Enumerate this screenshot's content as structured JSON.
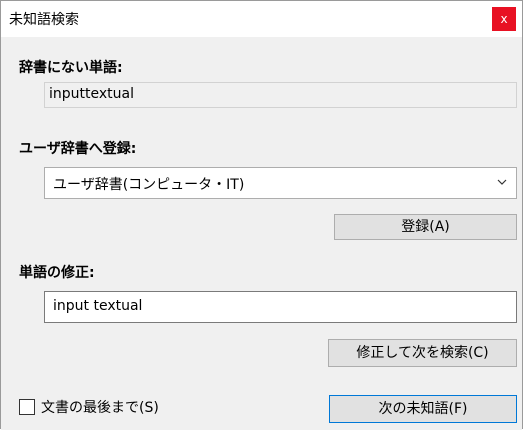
{
  "window": {
    "title": "未知語検索",
    "close_symbol": "x"
  },
  "labels": {
    "not_in_dict": "辞書にない単語:",
    "register_to": "ユーザ辞書へ登録:",
    "correction": "単語の修正:"
  },
  "fields": {
    "unknown_word": "inputtextual",
    "dictionary_selected": "ユーザ辞書(コンピュータ・IT)",
    "corrected_word": "input textual"
  },
  "buttons": {
    "register": "登録(A)",
    "fix_and_search": "修正して次を検索(C)",
    "next_unknown": "次の未知語(F)"
  },
  "checkbox": {
    "label": "文書の最後まで(S)",
    "checked": false
  },
  "colors": {
    "close_bg": "#e81123",
    "primary_border": "#0078d7"
  },
  "icons": {
    "close": "close-icon",
    "dropdown": "chevron-down-icon"
  }
}
